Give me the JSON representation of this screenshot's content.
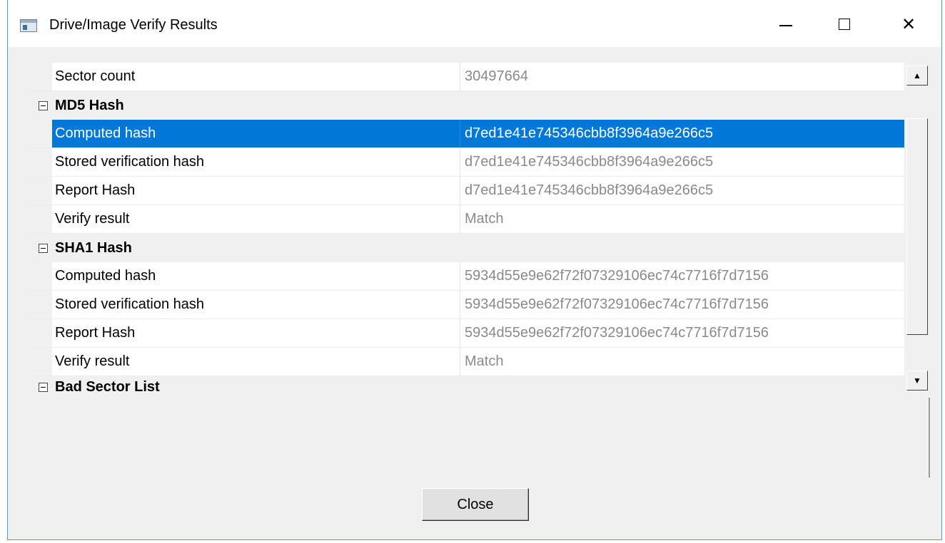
{
  "window": {
    "title": "Drive/Image Verify Results"
  },
  "grid": {
    "rows": [
      {
        "type": "prop",
        "name": "Sector count",
        "value": "30497664"
      },
      {
        "type": "category",
        "name": "MD5 Hash"
      },
      {
        "type": "prop",
        "name": "Computed hash",
        "value": "d7ed1e41e745346cbb8f3964a9e266c5",
        "selected": true
      },
      {
        "type": "prop",
        "name": "Stored verification hash",
        "value": "d7ed1e41e745346cbb8f3964a9e266c5"
      },
      {
        "type": "prop",
        "name": "Report Hash",
        "value": "d7ed1e41e745346cbb8f3964a9e266c5"
      },
      {
        "type": "prop",
        "name": "Verify result",
        "value": "Match"
      },
      {
        "type": "category",
        "name": "SHA1 Hash"
      },
      {
        "type": "prop",
        "name": "Computed hash",
        "value": "5934d55e9e62f72f07329106ec74c7716f7d7156"
      },
      {
        "type": "prop",
        "name": "Stored verification hash",
        "value": "5934d55e9e62f72f07329106ec74c7716f7d7156"
      },
      {
        "type": "prop",
        "name": "Report Hash",
        "value": "5934d55e9e62f72f07329106ec74c7716f7d7156"
      },
      {
        "type": "prop",
        "name": "Verify result",
        "value": "Match"
      },
      {
        "type": "category",
        "name": "Bad Sector List"
      }
    ]
  },
  "buttons": {
    "close_label": "Close"
  },
  "icons": {
    "scroll_up": "▲",
    "scroll_down": "▼",
    "close_window": "✕"
  },
  "colors": {
    "selection": "#0078d7",
    "window_border": "#4a9fd4"
  }
}
